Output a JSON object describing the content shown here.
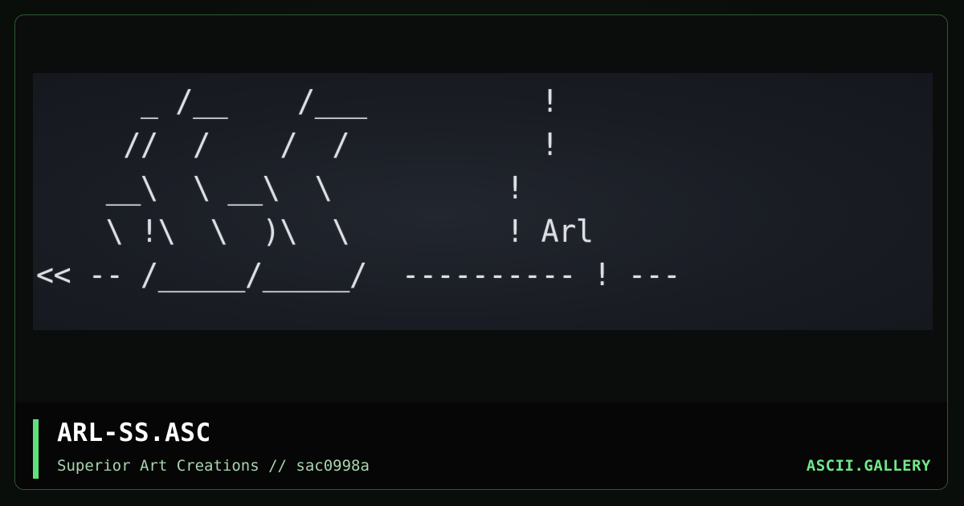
{
  "art": {
    "lines": [
      "      _ /__    /___          !",
      "     //  /    /  /           !",
      "    __\\  \\ __\\  \\          !",
      "    \\ !\\  \\  )\\  \\         ! Arl",
      "<< -- /_____/_____/  ---------- ! ---"
    ]
  },
  "footer": {
    "title": "ARL-SS.ASC",
    "subtitle": "Superior Art Creations // sac0998a",
    "brand": "ASCII.GALLERY"
  },
  "colors": {
    "accent": "#5fe07a",
    "brand": "#6fe88a",
    "border": "#2c5a32",
    "art_background": "#1d2027",
    "art_text": "#dcdfe3"
  }
}
